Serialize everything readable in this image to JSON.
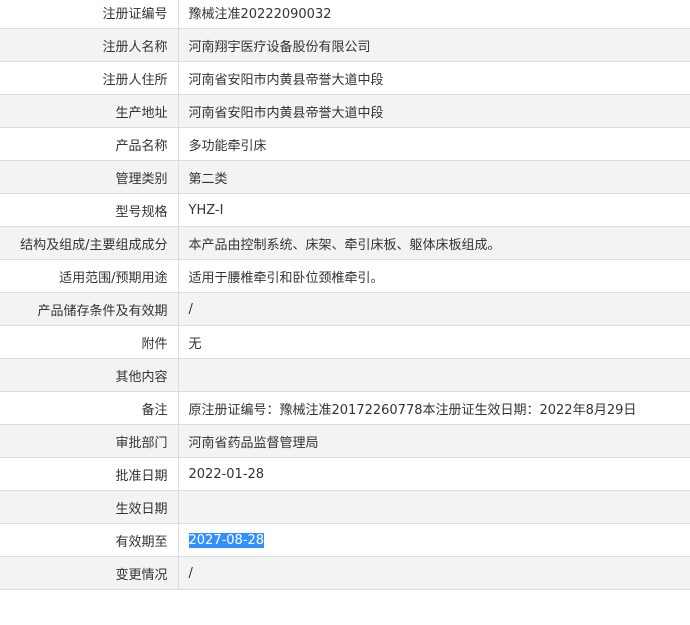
{
  "rows": [
    {
      "label": "注册证编号",
      "value": "豫械注准20222090032"
    },
    {
      "label": "注册人名称",
      "value": "河南翔宇医疗设备股份有限公司"
    },
    {
      "label": "注册人住所",
      "value": "河南省安阳市内黄县帝誉大道中段"
    },
    {
      "label": "生产地址",
      "value": "河南省安阳市内黄县帝誉大道中段"
    },
    {
      "label": "产品名称",
      "value": "多功能牵引床"
    },
    {
      "label": "管理类别",
      "value": "第二类"
    },
    {
      "label": "型号规格",
      "value": "YHZ-I"
    },
    {
      "label": "结构及组成/主要组成成分",
      "value": "本产品由控制系统、床架、牵引床板、躯体床板组成。"
    },
    {
      "label": "适用范围/预期用途",
      "value": "适用于腰椎牵引和卧位颈椎牵引。"
    },
    {
      "label": "产品储存条件及有效期",
      "value": "/"
    },
    {
      "label": "附件",
      "value": "无"
    },
    {
      "label": "其他内容",
      "value": ""
    },
    {
      "label": "备注",
      "value": "原注册证编号：豫械注准20172260778本注册证生效日期：2022年8月29日"
    },
    {
      "label": "审批部门",
      "value": "河南省药品监督管理局"
    },
    {
      "label": "批准日期",
      "value": "2022-01-28"
    },
    {
      "label": "生效日期",
      "value": ""
    },
    {
      "label": "有效期至",
      "value": "2027-08-28",
      "selected": true
    },
    {
      "label": "变更情况",
      "value": "/"
    }
  ]
}
